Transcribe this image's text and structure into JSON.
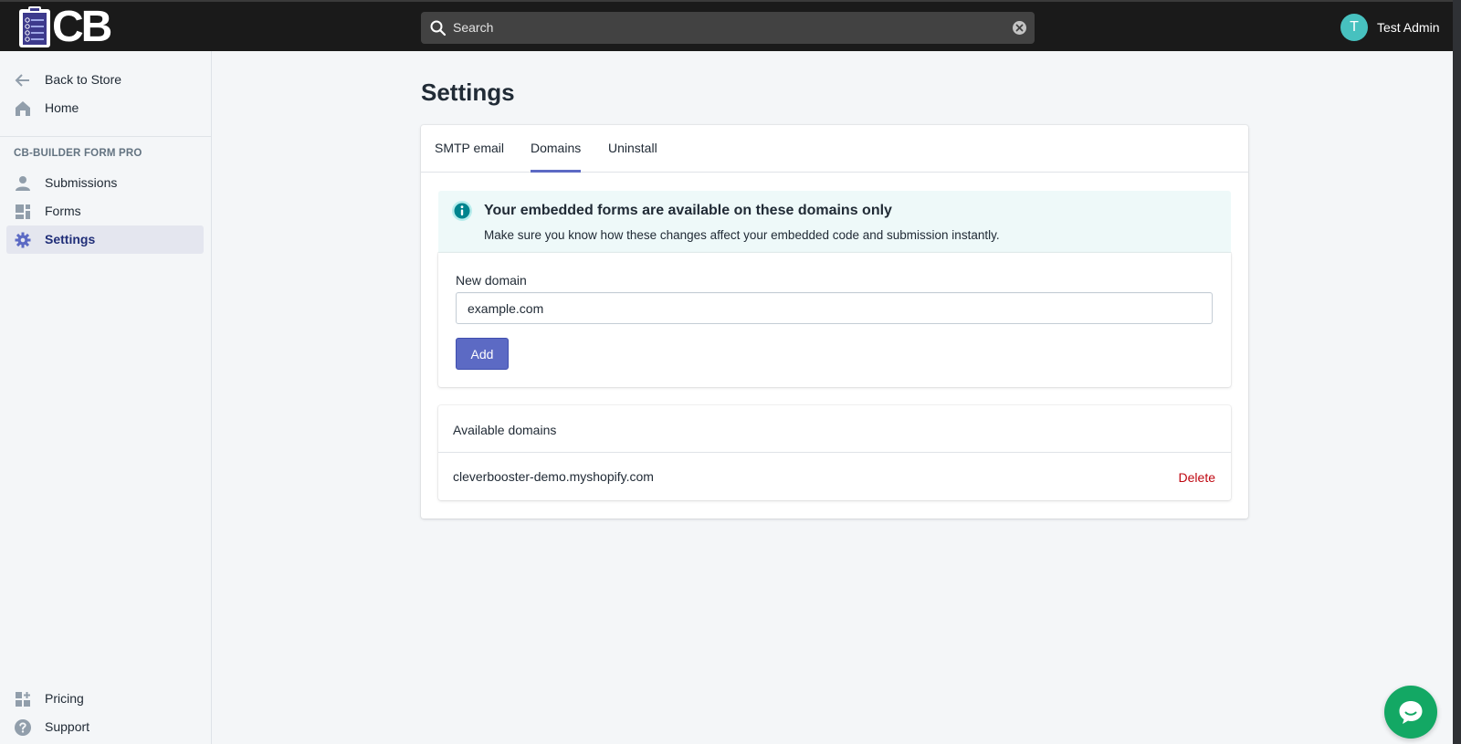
{
  "app": {
    "logo_text": "CB"
  },
  "search": {
    "placeholder": "Search"
  },
  "user": {
    "initial": "T",
    "name": "Test Admin"
  },
  "sidebar": {
    "top_items": [
      {
        "label": "Back to Store",
        "icon": "arrow-left-icon"
      },
      {
        "label": "Home",
        "icon": "home-icon"
      }
    ],
    "section_title": "CB-BUILDER FORM PRO",
    "items": [
      {
        "label": "Submissions",
        "icon": "person-icon"
      },
      {
        "label": "Forms",
        "icon": "forms-icon"
      },
      {
        "label": "Settings",
        "icon": "gear-icon",
        "active": true
      }
    ],
    "bottom_items": [
      {
        "label": "Pricing",
        "icon": "apps-icon"
      },
      {
        "label": "Support",
        "icon": "question-icon"
      }
    ]
  },
  "page": {
    "title": "Settings"
  },
  "tabs": [
    {
      "label": "SMTP email"
    },
    {
      "label": "Domains",
      "active": true
    },
    {
      "label": "Uninstall"
    }
  ],
  "banner": {
    "title": "Your embedded forms are available on these domains only",
    "text": "Make sure you know how these changes affect your embedded code and submission instantly."
  },
  "new_domain": {
    "label": "New domain",
    "value": "example.com",
    "button": "Add"
  },
  "available": {
    "title": "Available domains",
    "domains": [
      {
        "name": "cleverbooster-demo.myshopify.com",
        "action": "Delete"
      }
    ]
  },
  "colors": {
    "accent": "#5c6ac4",
    "topbar": "#1a1a1a",
    "avatar": "#47c1bf",
    "danger": "#bf0711",
    "chat": "#13a864",
    "banner": "#eef9f9"
  }
}
